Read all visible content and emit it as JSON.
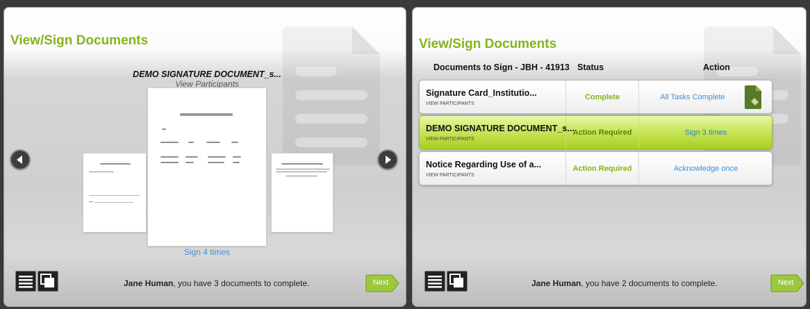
{
  "left_panel": {
    "title": "View/Sign Documents",
    "carousel": {
      "document_title": "DEMO SIGNATURE DOCUMENT_s...",
      "view_participants": "View Participants",
      "sign_count": "Sign 4 times"
    },
    "footer": {
      "user_name": "Jane Human",
      "message": ", you have 3 documents to complete.",
      "next_label": "Next"
    }
  },
  "right_panel": {
    "title": "View/Sign Documents",
    "table": {
      "headers": {
        "documents": "Documents to Sign - JBH - 41913",
        "status": "Status",
        "action": "Action"
      },
      "rows": [
        {
          "name": "Signature Card_Institutio...",
          "view_participants": "VIEW PARTICIPANTS",
          "status": "Complete",
          "action": "All Tasks Complete"
        },
        {
          "name": "DEMO SIGNATURE DOCUMENT_s...",
          "view_participants": "VIEW PARTICIPANTS",
          "status": "Action Required",
          "action": "Sign 3 times"
        },
        {
          "name": "Notice Regarding Use of a...",
          "view_participants": "VIEW PARTICIPANTS",
          "status": "Action Required",
          "action": "Acknowledge once"
        }
      ]
    },
    "footer": {
      "user_name": "Jane Human",
      "message": ", you have 2 documents to complete.",
      "next_label": "Next"
    }
  },
  "colors": {
    "accent_green": "#86b31e",
    "link_blue": "#3f8fd8",
    "selected_row": "#bfe04a"
  },
  "icons": [
    "document-watermark-icon",
    "arrow-left-icon",
    "arrow-right-icon",
    "list-view-icon",
    "carousel-view-icon",
    "signed-document-icon",
    "next-arrow-icon"
  ]
}
